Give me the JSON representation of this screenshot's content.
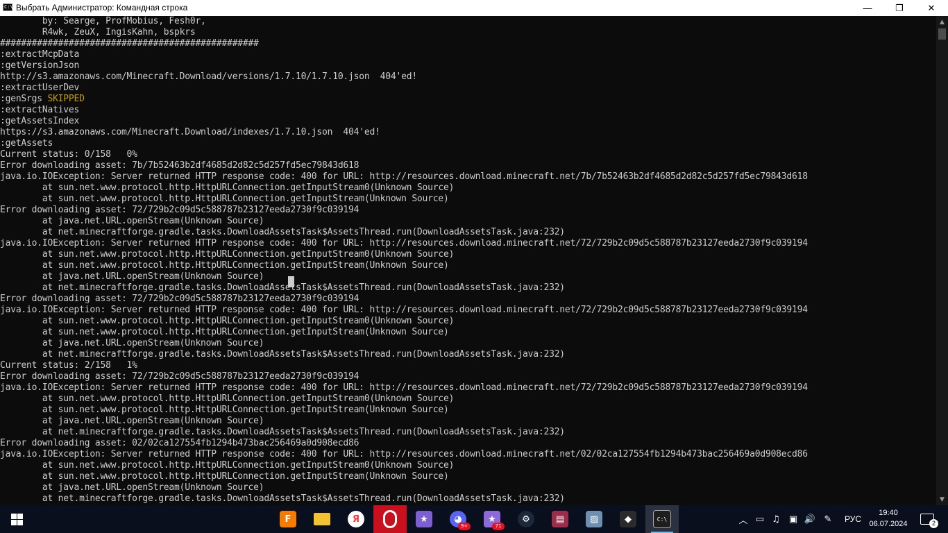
{
  "window": {
    "title": "Выбрать Администратор: Командная строка",
    "app_icon_text": "C:\\",
    "controls": {
      "minimize": "—",
      "maximize": "❐",
      "close": "✕"
    }
  },
  "console": {
    "lines": [
      "        by: Searge, ProfMobius, Fesh0r,",
      "        R4wk, ZeuX, IngisKahn, bspkrs",
      "#################################################",
      ":extractMcpData",
      ":getVersionJson",
      "http://s3.amazonaws.com/Minecraft.Download/versions/1.7.10/1.7.10.json  404'ed!",
      ":extractUserDev",
      ":genSrgs ",
      ":extractNatives",
      ":getAssetsIndex",
      "https://s3.amazonaws.com/Minecraft.Download/indexes/1.7.10.json  404'ed!",
      ":getAssets",
      "Current status: 0/158   0%",
      "Error downloading asset: 7b/7b52463b2df4685d2d82c5d257fd5ec79843d618",
      "java.io.IOException: Server returned HTTP response code: 400 for URL: http://resources.download.minecraft.net/7b/7b52463b2df4685d2d82c5d257fd5ec79843d618",
      "        at sun.net.www.protocol.http.HttpURLConnection.getInputStream0(Unknown Source)",
      "        at sun.net.www.protocol.http.HttpURLConnection.getInputStream(Unknown Source)",
      "Error downloading asset: 72/729b2c09d5c588787b23127eeda2730f9c039194",
      "        at java.net.URL.openStream(Unknown Source)",
      "        at net.minecraftforge.gradle.tasks.DownloadAssetsTask$AssetsThread.run(DownloadAssetsTask.java:232)",
      "java.io.IOException: Server returned HTTP response code: 400 for URL: http://resources.download.minecraft.net/72/729b2c09d5c588787b23127eeda2730f9c039194",
      "        at sun.net.www.protocol.http.HttpURLConnection.getInputStream0(Unknown Source)",
      "        at sun.net.www.protocol.http.HttpURLConnection.getInputStream(Unknown Source)",
      "        at java.net.URL.openStream(Unknown Source)",
      "        at net.minecraftforge.gradle.tasks.DownloadAssetsTask$AssetsThread.run(DownloadAssetsTask.java:232)",
      "Error downloading asset: 72/729b2c09d5c588787b23127eeda2730f9c039194",
      "java.io.IOException: Server returned HTTP response code: 400 for URL: http://resources.download.minecraft.net/72/729b2c09d5c588787b23127eeda2730f9c039194",
      "        at sun.net.www.protocol.http.HttpURLConnection.getInputStream0(Unknown Source)",
      "        at sun.net.www.protocol.http.HttpURLConnection.getInputStream(Unknown Source)",
      "        at java.net.URL.openStream(Unknown Source)",
      "        at net.minecraftforge.gradle.tasks.DownloadAssetsTask$AssetsThread.run(DownloadAssetsTask.java:232)",
      "Current status: 2/158   1%",
      "Error downloading asset: 72/729b2c09d5c588787b23127eeda2730f9c039194",
      "java.io.IOException: Server returned HTTP response code: 400 for URL: http://resources.download.minecraft.net/72/729b2c09d5c588787b23127eeda2730f9c039194",
      "        at sun.net.www.protocol.http.HttpURLConnection.getInputStream0(Unknown Source)",
      "        at sun.net.www.protocol.http.HttpURLConnection.getInputStream(Unknown Source)",
      "        at java.net.URL.openStream(Unknown Source)",
      "        at net.minecraftforge.gradle.tasks.DownloadAssetsTask$AssetsThread.run(DownloadAssetsTask.java:232)",
      "Error downloading asset: 02/02ca127554fb1294b473bac256469a0d908ecd86",
      "java.io.IOException: Server returned HTTP response code: 400 for URL: http://resources.download.minecraft.net/02/02ca127554fb1294b473bac256469a0d908ecd86",
      "        at sun.net.www.protocol.http.HttpURLConnection.getInputStream0(Unknown Source)",
      "        at sun.net.www.protocol.http.HttpURLConnection.getInputStream(Unknown Source)",
      "        at java.net.URL.openStream(Unknown Source)",
      "        at net.minecraftforge.gradle.tasks.DownloadAssetsTask$AssetsThread.run(DownloadAssetsTask.java:232)"
    ],
    "skipped_label": "SKIPPED",
    "colors": {
      "text": "#cccccc",
      "skipped": "#c19c00",
      "background": "#0c0c0c"
    }
  },
  "scrollbar": {
    "up": "▲",
    "down": "▼"
  },
  "taskbar": {
    "apps": [
      {
        "name": "fl-studio-icon",
        "glyph": "F",
        "color": "#f57c00"
      },
      {
        "name": "file-explorer-icon",
        "glyph": "",
        "color": "#f2c230"
      },
      {
        "name": "yandex-browser-icon",
        "glyph": "Я",
        "color": "#ff3333"
      },
      {
        "name": "opera-icon",
        "glyph": "O",
        "color": "#d5001c"
      },
      {
        "name": "chat-app-icon",
        "glyph": "★",
        "color": "#7d5fd1"
      },
      {
        "name": "discord-icon",
        "glyph": "◕",
        "color": "#5865f2",
        "badge": "9+"
      },
      {
        "name": "fox-app-icon",
        "glyph": "★",
        "color": "#8e6ad8",
        "badge": "71"
      },
      {
        "name": "steam-icon",
        "glyph": "⚙",
        "color": "#1b2838"
      },
      {
        "name": "winrar-icon",
        "glyph": "▤",
        "color": "#9c2c4c"
      },
      {
        "name": "photos-icon",
        "glyph": "▨",
        "color": "#6f8fb0"
      },
      {
        "name": "security-icon",
        "glyph": "◆",
        "color": "#2b2b2b"
      },
      {
        "name": "command-prompt-icon",
        "glyph": "C:\\",
        "color": "#1e1e1e"
      }
    ],
    "tray": {
      "chevron": "︿",
      "icons": [
        "▭",
        "♫",
        "▣",
        "🔊",
        "✎"
      ],
      "language": "РУС",
      "time": "19:40",
      "date": "06.07.2024",
      "notifications": "2"
    }
  }
}
